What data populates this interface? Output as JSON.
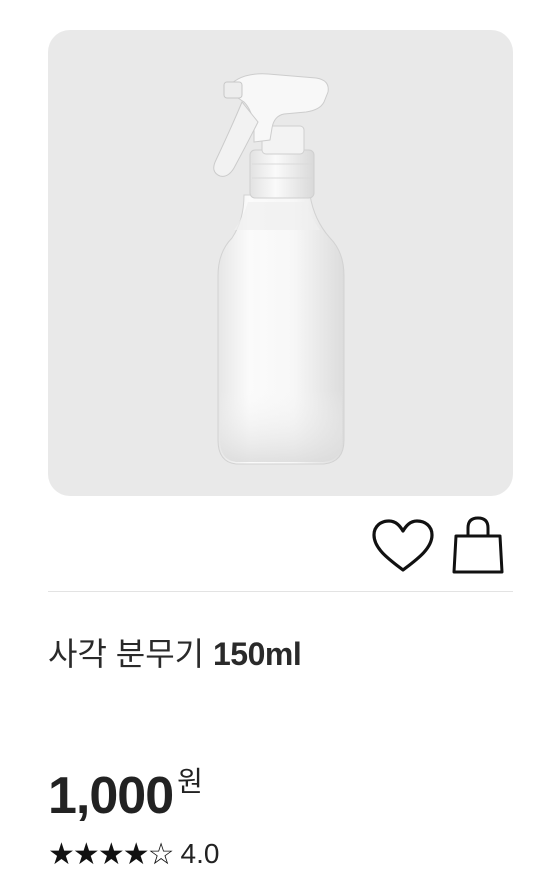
{
  "product": {
    "name": "사각 분무기",
    "size": "150ml",
    "price": "1,000",
    "currency": "원",
    "rating": 4.0,
    "rating_text": "4.0",
    "stars_filled": 4,
    "stars_total": 5,
    "image_icon": "spray-bottle-image"
  },
  "actions": {
    "wish_icon": "heart-icon",
    "cart_icon": "shopping-bag-icon"
  },
  "colors": {
    "image_bg": "#e9e9e9",
    "text": "#222222",
    "divider": "#e3e3e3"
  }
}
